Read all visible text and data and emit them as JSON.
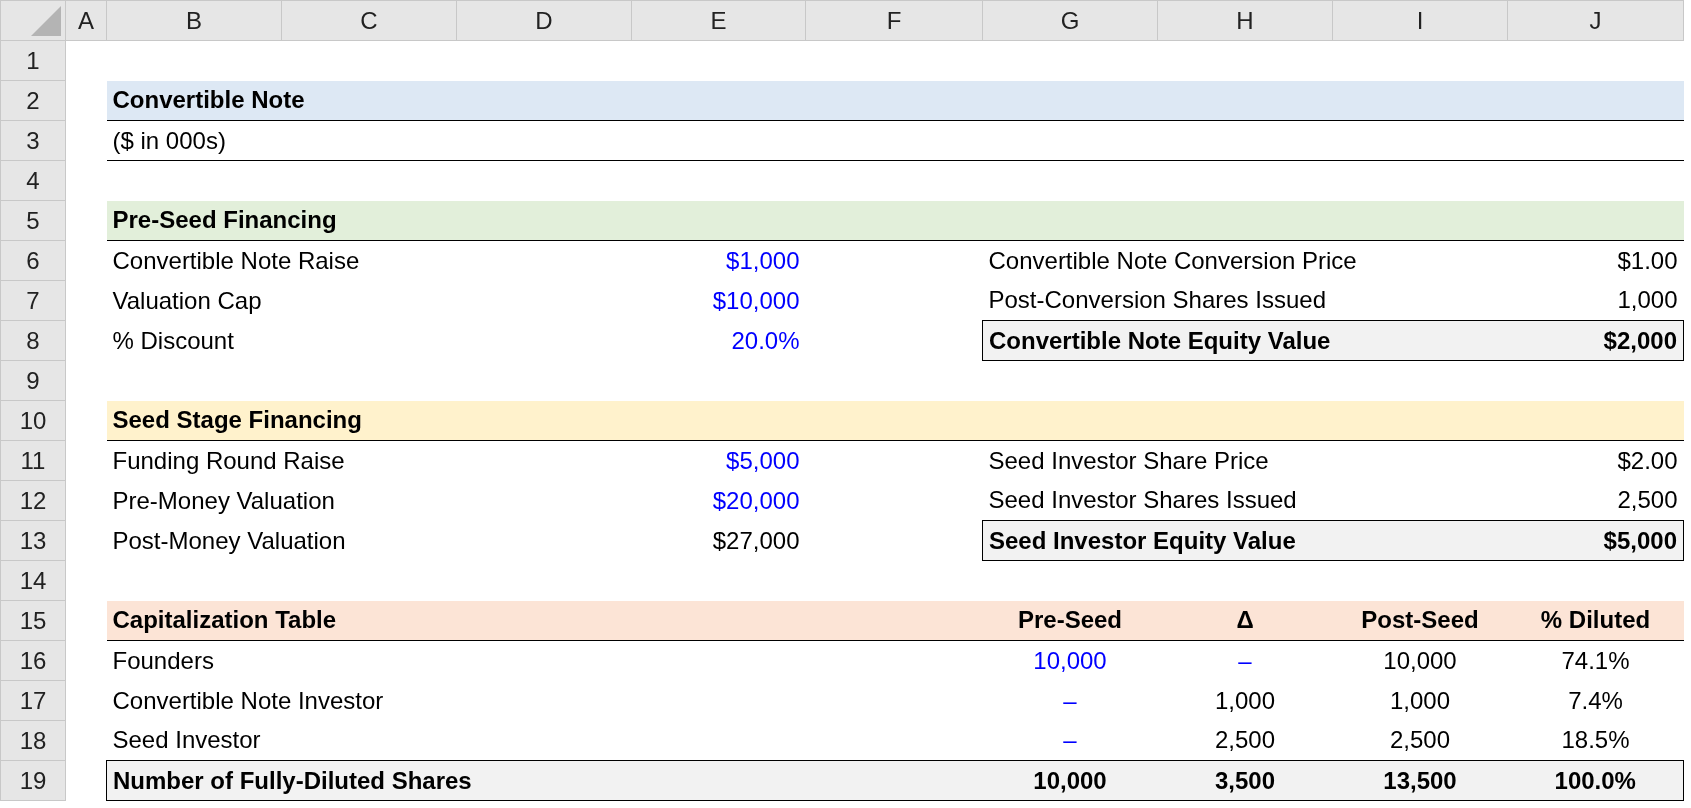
{
  "columns": [
    "A",
    "B",
    "C",
    "D",
    "E",
    "F",
    "G",
    "H",
    "I",
    "J"
  ],
  "row_numbers": [
    "1",
    "2",
    "3",
    "4",
    "5",
    "6",
    "7",
    "8",
    "9",
    "10",
    "11",
    "12",
    "13",
    "14",
    "15",
    "16",
    "17",
    "18",
    "19"
  ],
  "title": {
    "text": "Convertible Note",
    "color": "#dde8f4"
  },
  "subtitle": "($ in 000s)",
  "sections": [
    {
      "title": "Pre-Seed Financing",
      "color": "#e2efda",
      "rows": [
        {
          "label": "Convertible Note Raise",
          "value": "$1,000",
          "input": true,
          "right_label": "Convertible Note Conversion Price",
          "right_value": "$1.00"
        },
        {
          "label": "Valuation Cap",
          "value": "$10,000",
          "input": true,
          "right_label": "Post-Conversion Shares Issued",
          "right_value": "1,000"
        },
        {
          "label": "% Discount",
          "value": "20.0%",
          "input": true,
          "right_label": "Convertible Note Equity Value",
          "right_value": "$2,000",
          "total": true
        }
      ]
    },
    {
      "title": "Seed Stage Financing",
      "color": "#fff2cc",
      "rows": [
        {
          "label": "Funding Round Raise",
          "value": "$5,000",
          "input": true,
          "right_label": "Seed Investor Share Price",
          "right_value": "$2.00"
        },
        {
          "label": "Pre-Money Valuation",
          "value": "$20,000",
          "input": true,
          "right_label": "Seed Investor Shares Issued",
          "right_value": "2,500"
        },
        {
          "label": "Post-Money Valuation",
          "value": "$27,000",
          "input": false,
          "right_label": "Seed Investor Equity Value",
          "right_value": "$5,000",
          "total": true
        }
      ]
    }
  ],
  "cap_table": {
    "title": "Capitalization Table",
    "color": "#fce4d6",
    "columns": [
      "Pre-Seed",
      "Δ",
      "Post-Seed",
      "% Diluted"
    ],
    "rows": [
      {
        "label": "Founders",
        "total": false,
        "cells": [
          {
            "text": "10,000",
            "input": true
          },
          {
            "text": "–",
            "input": true
          },
          {
            "text": "10,000",
            "input": false
          },
          {
            "text": "74.1%",
            "input": false
          }
        ]
      },
      {
        "label": "Convertible Note Investor",
        "total": false,
        "cells": [
          {
            "text": "–",
            "input": true
          },
          {
            "text": "1,000",
            "input": false
          },
          {
            "text": "1,000",
            "input": false
          },
          {
            "text": "7.4%",
            "input": false
          }
        ]
      },
      {
        "label": "Seed Investor",
        "total": false,
        "cells": [
          {
            "text": "–",
            "input": true
          },
          {
            "text": "2,500",
            "input": false
          },
          {
            "text": "2,500",
            "input": false
          },
          {
            "text": "18.5%",
            "input": false
          }
        ]
      },
      {
        "label": "Number of Fully-Diluted Shares",
        "total": true,
        "cells": [
          {
            "text": "10,000",
            "input": false
          },
          {
            "text": "3,500",
            "input": false
          },
          {
            "text": "13,500",
            "input": false
          },
          {
            "text": "100.0%",
            "input": false
          }
        ]
      }
    ]
  }
}
